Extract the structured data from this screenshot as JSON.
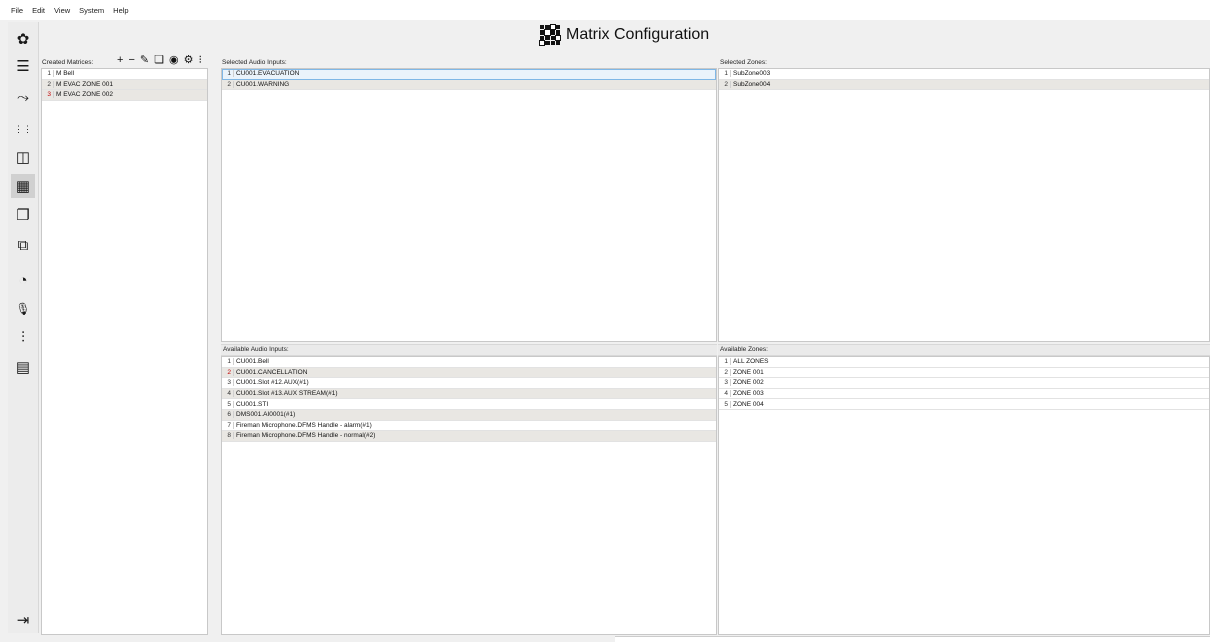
{
  "menu": [
    "File",
    "Edit",
    "View",
    "System",
    "Help"
  ],
  "sidebar": [
    {
      "icon": "gear-icon",
      "glyph": "✿"
    },
    {
      "icon": "server-icon",
      "glyph": "☰"
    },
    {
      "icon": "route-icon",
      "glyph": "⤳"
    },
    {
      "icon": "audio-channels-icon",
      "glyph": "⋮⋮"
    },
    {
      "icon": "input-output-icon",
      "glyph": "◫"
    },
    {
      "icon": "matrix-icon",
      "glyph": "▦"
    },
    {
      "icon": "windows-icon",
      "glyph": "❐"
    },
    {
      "icon": "connection-icon",
      "glyph": "⧉"
    },
    {
      "icon": "gauge-icon",
      "glyph": "◔"
    },
    {
      "icon": "microphone-icon",
      "glyph": "🎙"
    },
    {
      "icon": "mixer-icon",
      "glyph": "⫶"
    },
    {
      "icon": "document-icon",
      "glyph": "▤"
    },
    {
      "icon": "logout-icon",
      "glyph": "⇥"
    }
  ],
  "title": "Matrix Configuration",
  "created_matrices": {
    "label": "Created Matrices:",
    "toolbar": [
      {
        "icon": "add-icon",
        "glyph": "+"
      },
      {
        "icon": "remove-icon",
        "glyph": "−"
      },
      {
        "icon": "edit-icon",
        "glyph": "✎"
      },
      {
        "icon": "copy-icon",
        "glyph": "❏"
      },
      {
        "icon": "view-icon",
        "glyph": "◉"
      },
      {
        "icon": "settings-icon",
        "glyph": "⚙"
      },
      {
        "icon": "grid-icon",
        "glyph": "⁝"
      }
    ],
    "items": [
      {
        "num": "1",
        "text": "M Bell",
        "red": false
      },
      {
        "num": "2",
        "text": "M EVAC ZONE 001",
        "red": false
      },
      {
        "num": "3",
        "text": "M EVAC ZONE 002",
        "red": true
      }
    ]
  },
  "selected_inputs": {
    "label": "Selected Audio Inputs:",
    "items": [
      {
        "num": "1",
        "text": "CU001.EVACUATION"
      },
      {
        "num": "2",
        "text": "CU001.WARNING"
      }
    ]
  },
  "selected_zones": {
    "label": "Selected Zones:",
    "items": [
      {
        "num": "1",
        "text": "SubZone003"
      },
      {
        "num": "2",
        "text": "SubZone004"
      }
    ]
  },
  "available_inputs": {
    "label": "Available Audio Inputs:",
    "items": [
      {
        "num": "1",
        "text": "CU001.Bell",
        "red": false
      },
      {
        "num": "2",
        "text": "CU001.CANCELLATION",
        "red": true
      },
      {
        "num": "3",
        "text": "CU001.Slot #12.AUX(#1)",
        "red": false
      },
      {
        "num": "4",
        "text": "CU001.Slot #13.AUX STREAM(#1)",
        "red": false
      },
      {
        "num": "5",
        "text": "CU001.STI",
        "red": false
      },
      {
        "num": "6",
        "text": "DMS001.AI0001(#1)",
        "red": false
      },
      {
        "num": "7",
        "text": "Fireman Microphone.DFMS Handle - alarm(#1)",
        "red": false
      },
      {
        "num": "8",
        "text": "Fireman Microphone.DFMS Handle - normal(#2)",
        "red": false
      }
    ]
  },
  "available_zones": {
    "label": "Available Zones:",
    "items": [
      {
        "num": "1",
        "text": "ALL ZONES"
      },
      {
        "num": "2",
        "text": "ZONE 001"
      },
      {
        "num": "3",
        "text": "ZONE 002"
      },
      {
        "num": "4",
        "text": "ZONE 003"
      },
      {
        "num": "5",
        "text": "ZONE 004"
      }
    ]
  }
}
